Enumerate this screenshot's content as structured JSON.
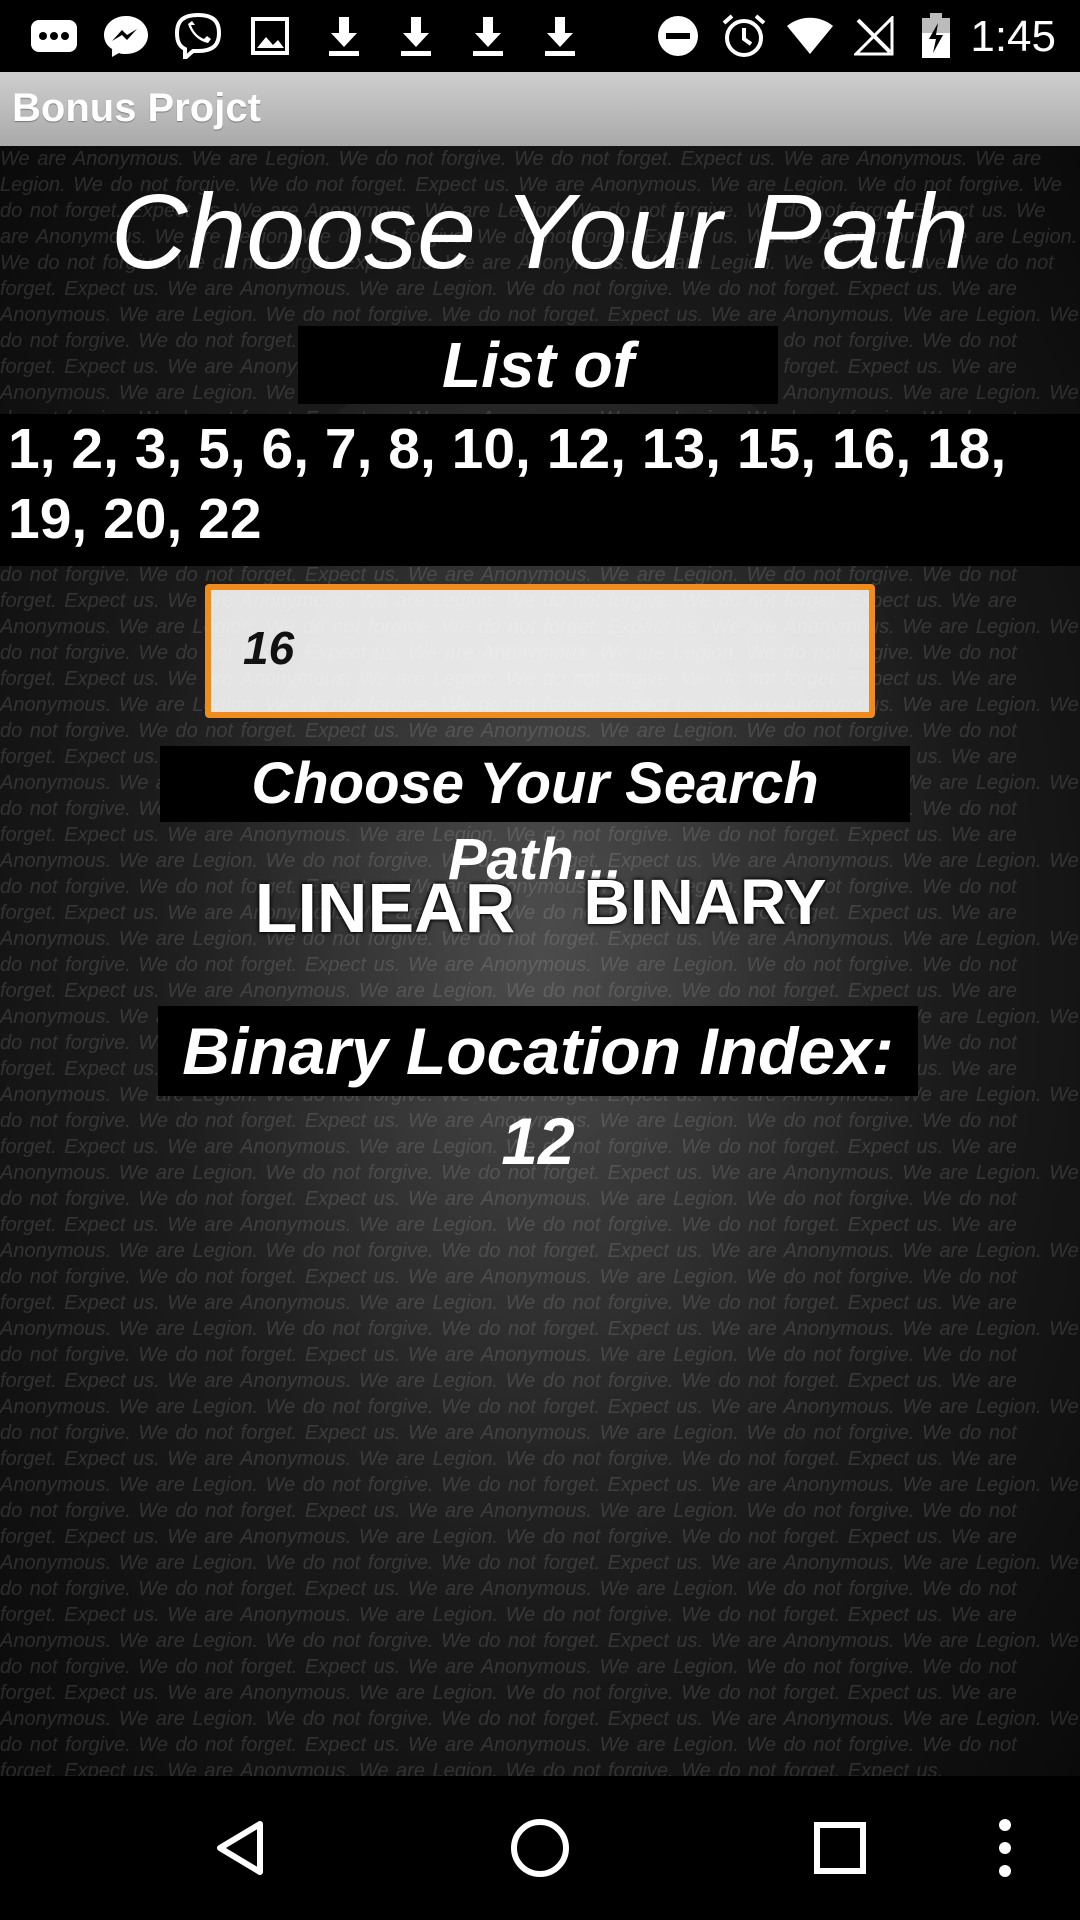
{
  "status_bar": {
    "time": "1:45",
    "icons": [
      "chat-icon",
      "messenger-icon",
      "viber-icon",
      "image-icon",
      "download-icon",
      "download-icon",
      "download-icon",
      "download-icon",
      "do-not-disturb-icon",
      "alarm-icon",
      "wifi-icon",
      "no-signal-icon",
      "battery-charging-icon"
    ]
  },
  "app_bar": {
    "title": "Bonus Projct"
  },
  "main": {
    "heading": "Choose Your Path",
    "list_heading": "List of Numbers",
    "numbers_text": "1, 2, 3, 5, 6, 7, 8, 10, 12, 13, 15, 16, 18, 19, 20, 22",
    "search_input": {
      "value": "16"
    },
    "search_prompt": "Choose Your Search Path...",
    "linear_button": "LINEAR",
    "binary_button": "BINARY",
    "result_text": "Binary Location Index: 12"
  },
  "nav_bar": {
    "icons": [
      "back-icon",
      "home-icon",
      "recents-icon",
      "overflow-menu-icon"
    ]
  },
  "colors": {
    "input_border": "#f08c1c",
    "app_bar": "#bdbdbd"
  }
}
